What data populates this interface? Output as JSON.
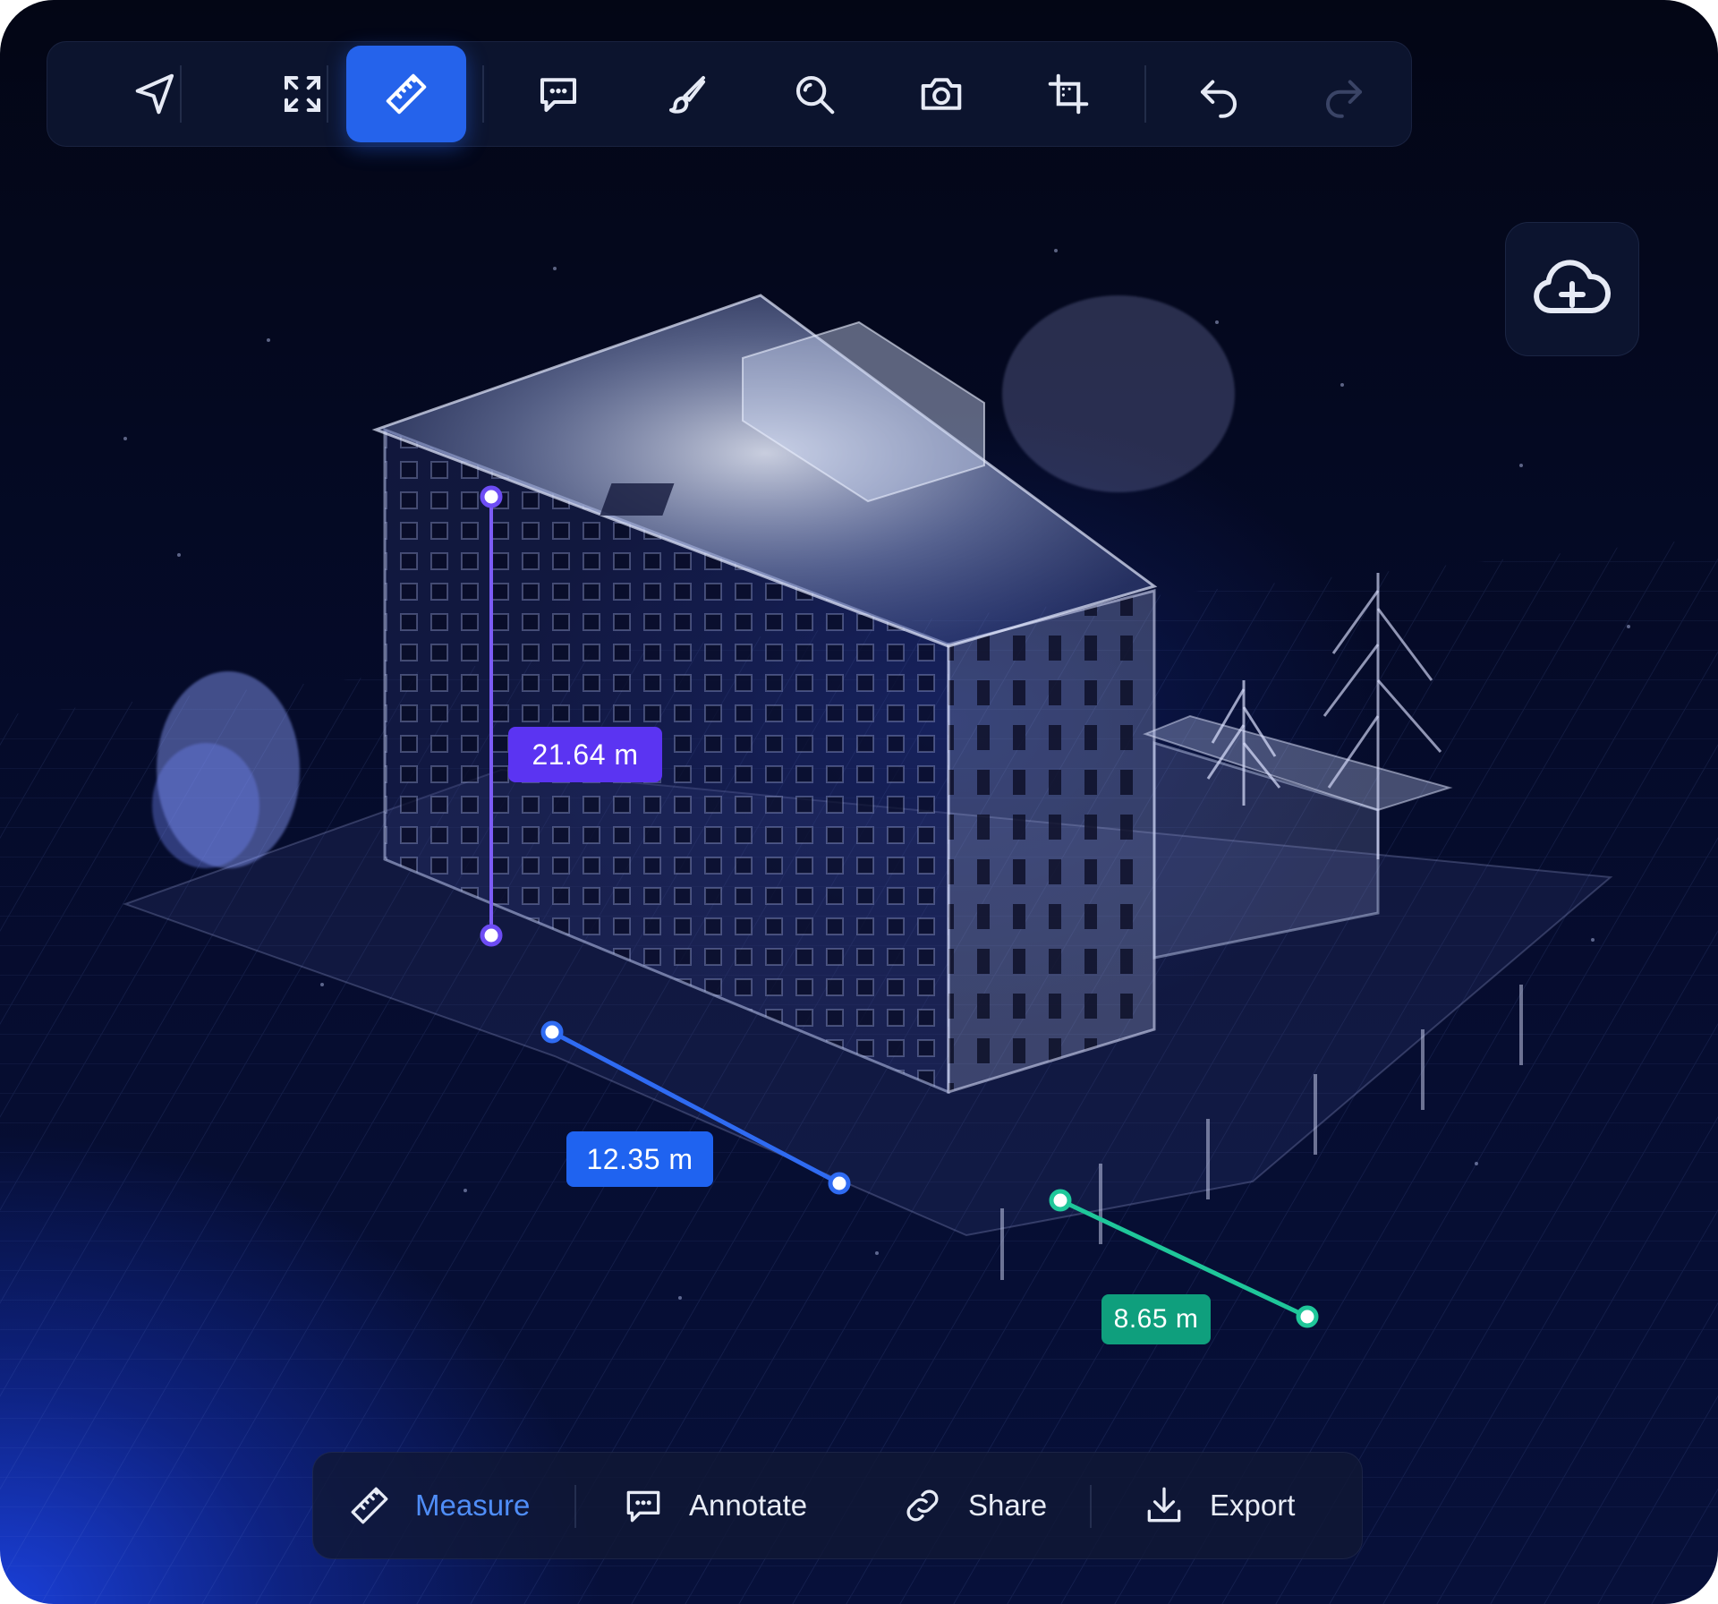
{
  "toolbar": {
    "tools": [
      {
        "name": "navigate-tool",
        "icon": "navigation-arrow-icon"
      },
      {
        "name": "fullscreen-tool",
        "icon": "expand-icon"
      },
      {
        "name": "measure-tool",
        "icon": "ruler-icon",
        "active": true
      },
      {
        "name": "comment-tool",
        "icon": "chat-bubble-icon"
      },
      {
        "name": "brush-tool",
        "icon": "brush-icon"
      },
      {
        "name": "zoom-tool",
        "icon": "magnifier-icon"
      },
      {
        "name": "screenshot-tool",
        "icon": "camera-icon"
      },
      {
        "name": "crop-tool",
        "icon": "crop-icon"
      },
      {
        "name": "undo-tool",
        "icon": "undo-icon"
      },
      {
        "name": "redo-tool",
        "icon": "redo-icon",
        "disabled": true
      }
    ]
  },
  "upload": {
    "icon": "cloud-plus-icon"
  },
  "measurements": {
    "height": {
      "value": "21.64 m",
      "color": "#5b34f2"
    },
    "length": {
      "value": "12.35 m",
      "color": "#1f63f0"
    },
    "width": {
      "value": "8.65 m",
      "color": "#0f9f7d"
    }
  },
  "actions": {
    "measure": {
      "label": "Measure",
      "icon": "ruler-icon",
      "active": true
    },
    "annotate": {
      "label": "Annotate",
      "icon": "chat-bubble-icon"
    },
    "share": {
      "label": "Share",
      "icon": "link-icon"
    },
    "export": {
      "label": "Export",
      "icon": "download-icon"
    }
  },
  "colors": {
    "accent": "#2563eb",
    "active_text": "#4f8df8",
    "background": "#050b2a"
  }
}
